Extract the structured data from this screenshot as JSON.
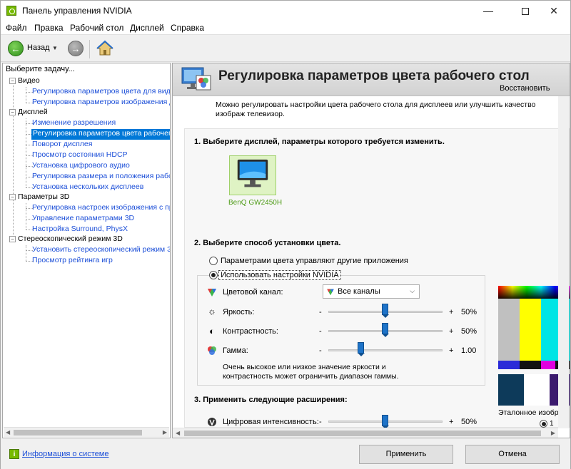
{
  "window": {
    "title": "Панель управления NVIDIA"
  },
  "menu": [
    "Файл",
    "Правка",
    "Рабочий стол",
    "Дисплей",
    "Справка"
  ],
  "toolbar": {
    "back_label": "Назад"
  },
  "task_panel": {
    "header": "Выберите задачу...",
    "tree": [
      {
        "type": "cat",
        "label": "Видео"
      },
      {
        "type": "link",
        "label": "Регулировка параметров цвета для вид"
      },
      {
        "type": "link",
        "label": "Регулировка параметров изображения д"
      },
      {
        "type": "cat",
        "label": "Дисплей"
      },
      {
        "type": "link",
        "label": "Изменение разрешения"
      },
      {
        "type": "link",
        "label": "Регулировка параметров цвета рабочег",
        "selected": true
      },
      {
        "type": "link",
        "label": "Поворот дисплея"
      },
      {
        "type": "link",
        "label": "Просмотр состояния HDCP"
      },
      {
        "type": "link",
        "label": "Установка цифрового аудио"
      },
      {
        "type": "link",
        "label": "Регулировка размера и положения рабо"
      },
      {
        "type": "link",
        "label": "Установка нескольких дисплеев"
      },
      {
        "type": "cat",
        "label": "Параметры 3D"
      },
      {
        "type": "link",
        "label": "Регулировка настроек изображения с пр"
      },
      {
        "type": "link",
        "label": "Управление параметрами 3D"
      },
      {
        "type": "link",
        "label": "Настройка Surround, PhysX"
      },
      {
        "type": "cat",
        "label": "Стереоскопический режим 3D"
      },
      {
        "type": "link",
        "label": "Установить стереоскопический режим 3"
      },
      {
        "type": "link",
        "label": "Просмотр рейтинга игр"
      }
    ]
  },
  "content": {
    "title": "Регулировка параметров цвета рабочего стол",
    "restore": "Восстановить",
    "description": "Можно регулировать настройки цвета рабочего стола для дисплеев или улучшить качество изображ телевизор.",
    "section1": "1. Выберите дисплей, параметры которого требуется изменить.",
    "display_name": "BenQ GW2450H",
    "section2": "2. Выберите способ установки цвета.",
    "radio_other": "Параметрами цвета управляют другие приложения",
    "radio_nvidia": "Использовать настройки NVIDIA",
    "channel_label": "Цветовой канал:",
    "channel_value": "Все каналы",
    "brightness_label": "Яркость:",
    "brightness_value": "50%",
    "brightness_level": 0.5,
    "contrast_label": "Контрастность:",
    "contrast_value": "50%",
    "contrast_level": 0.5,
    "gamma_label": "Гамма:",
    "gamma_value": "1.00",
    "gamma_level": 0.29,
    "minus": "-",
    "plus": "+",
    "note": "Очень высокое или низкое значение яркости и контрастность может ограничить диапазон гаммы.",
    "section3": "3. Применить следующие расширения:",
    "vibrance_label": "Цифровая интенсивность:",
    "vibrance_value": "50%",
    "vibrance_level": 0.5,
    "reference_caption": "Эталонное изобра",
    "reference_radio": "1"
  },
  "bottom": {
    "info_link": "Информация о системе",
    "apply": "Применить",
    "cancel": "Отмена"
  },
  "colors": {
    "nvidia_green": "#76b900",
    "selection": "#0078d7",
    "link": "#1c4fd8",
    "slider": "#1e73c8"
  }
}
